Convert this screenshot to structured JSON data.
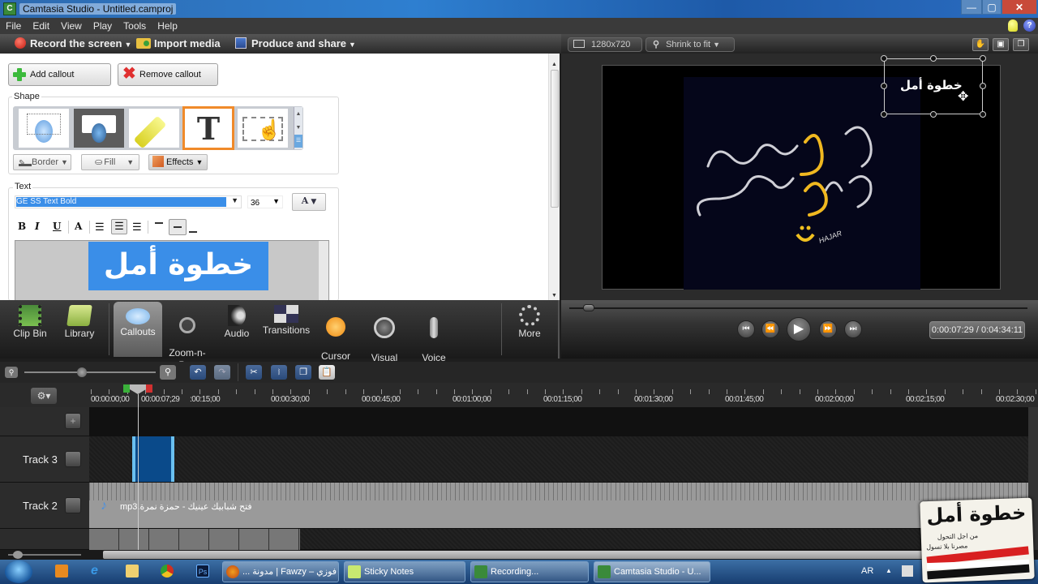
{
  "window": {
    "title": "Camtasia Studio - Untitled.camproj",
    "controls": {
      "minimize": "—",
      "maximize": "▢",
      "close": "✕"
    }
  },
  "menu": [
    "File",
    "Edit",
    "View",
    "Play",
    "Tools",
    "Help"
  ],
  "toolbar": {
    "record": "Record the screen",
    "import": "Import media",
    "produce": "Produce and share"
  },
  "callouts_panel": {
    "add_callout": "Add callout",
    "remove_callout": "Remove callout",
    "shape_label": "Shape",
    "shapes": [
      "shape-callout-light",
      "shape-callout-dark",
      "shape-highlight",
      "shape-text",
      "shape-hotspot"
    ],
    "selected_shape": "shape-text",
    "border": "Border",
    "fill": "Fill",
    "effects": "Effects",
    "text_label": "Text",
    "font": "GE SS Text Bold",
    "font_size": "36",
    "format_buttons": {
      "bold": "B",
      "italic": "I",
      "underline": "U",
      "shadow": "A"
    },
    "text_content": "خطوة أمل",
    "text_color_icon": "A"
  },
  "task_tabs": [
    {
      "label": "Clip Bin",
      "icon": "film-icon"
    },
    {
      "label": "Library",
      "icon": "folder-icon"
    },
    {
      "label": "Callouts",
      "icon": "speech-bubble-icon",
      "active": true
    },
    {
      "label": "Zoom-n-\nPan",
      "icon": "magnifier-icon"
    },
    {
      "label": "Audio",
      "icon": "speaker-icon"
    },
    {
      "label": "Transitions",
      "icon": "transition-icon"
    },
    {
      "label": "Cursor\nEffects",
      "icon": "cursor-icon"
    },
    {
      "label": "Visual\nProperties",
      "icon": "film-reel-icon"
    },
    {
      "label": "Voice\nNarration",
      "icon": "microphone-icon"
    },
    {
      "label": "More",
      "icon": "more-icon"
    }
  ],
  "preview": {
    "dimensions": "1280x720",
    "zoom": "Shrink to fit",
    "callout_text": "خطوة أمل",
    "timecode": "0:00:07:29 / 0:04:34:11",
    "playhead_fraction": 0.03
  },
  "timeline": {
    "ruler_labels": [
      "00:00:00;00",
      "00:00:07;29",
      ":00:15;00",
      "00:00:30;00",
      "00:00:45;00",
      "00:01:00;00",
      "00:01:15;00",
      "00:01:30;00",
      "00:01:45;00",
      "00:02:00;00",
      "00:02:15;00",
      "00:02:30;00"
    ],
    "tracks": [
      {
        "name": "Track 3"
      },
      {
        "name": "Track 2",
        "clip": "فتح شبابيك عينيك - حمزة نمرة.mp3"
      }
    ],
    "zoom_fraction": 0.4
  },
  "taskbar": {
    "buttons": [
      "... مدونة | Fawzy – فوزي",
      "Sticky Notes",
      "Recording...",
      "Camtasia Studio - U..."
    ],
    "lang": "AR"
  },
  "watermark": {
    "title": "خطوة أمل",
    "line1": "من اجل التحول",
    "line2": "مصرنا بلا تسول"
  }
}
